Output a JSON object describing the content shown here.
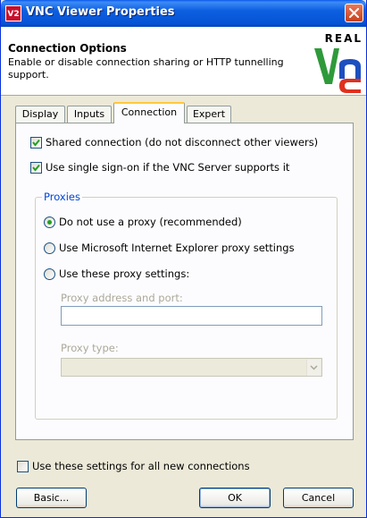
{
  "window": {
    "title": "VNC Viewer Properties",
    "icon_text": "V2"
  },
  "header": {
    "title": "Connection Options",
    "description": "Enable or disable connection sharing or HTTP tunnelling support.",
    "logo_text": "REAL"
  },
  "tabs": [
    {
      "label": "Display",
      "active": false
    },
    {
      "label": "Inputs",
      "active": false
    },
    {
      "label": "Connection",
      "active": true
    },
    {
      "label": "Expert",
      "active": false
    }
  ],
  "connection": {
    "shared_connection": {
      "label": "Shared connection (do not disconnect other viewers)",
      "checked": true
    },
    "single_sign_on": {
      "label": "Use single sign-on if the VNC Server supports it",
      "checked": true
    },
    "proxies": {
      "group_label": "Proxies",
      "options": [
        {
          "label": "Do not use a proxy (recommended)",
          "selected": true
        },
        {
          "label": "Use Microsoft Internet Explorer proxy settings",
          "selected": false
        },
        {
          "label": "Use these proxy settings:",
          "selected": false
        }
      ],
      "address_label": "Proxy address and port:",
      "address_value": "",
      "type_label": "Proxy type:",
      "type_value": ""
    }
  },
  "footer": {
    "all_connections": {
      "label": "Use these settings for all new connections",
      "checked": false
    },
    "basic_button": "Basic...",
    "ok_button": "OK",
    "cancel_button": "Cancel"
  },
  "colors": {
    "titlebar": "#0653d6",
    "tab_highlight": "#ffc83c",
    "group_label": "#0046d5",
    "radio_dot": "#21a121",
    "check_mark": "#21a121",
    "logo_green": "#2e9a3a",
    "logo_red": "#e0301e",
    "logo_blue": "#1e4fc0"
  }
}
